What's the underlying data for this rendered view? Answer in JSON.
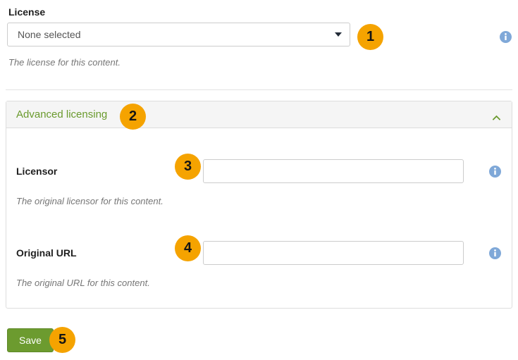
{
  "license_field": {
    "label": "License",
    "selected_value": "None selected",
    "help_text": "The license for this content.",
    "info_icon": "info-circle-icon",
    "dropdown_icon": "chevron-down-icon"
  },
  "advanced_panel": {
    "title": "Advanced licensing",
    "collapse_icon": "chevron-up-icon",
    "fields": [
      {
        "label": "Licensor",
        "value": "",
        "placeholder": "",
        "help_text": "The original licensor for this content.",
        "info_icon": "info-circle-icon"
      },
      {
        "label": "Original URL",
        "value": "",
        "placeholder": "",
        "help_text": "The original URL for this content.",
        "info_icon": "info-circle-icon"
      }
    ]
  },
  "actions": {
    "save_label": "Save"
  },
  "step_badges": [
    {
      "number": "1"
    },
    {
      "number": "2"
    },
    {
      "number": "3"
    },
    {
      "number": "4"
    },
    {
      "number": "5"
    }
  ],
  "colors": {
    "badge_background": "#f5a300",
    "badge_text": "#141414",
    "panel_title": "#6a9a2d",
    "save_button": "#6c9b2f",
    "info_icon": "#7fa8d8",
    "help_text": "#767676"
  }
}
